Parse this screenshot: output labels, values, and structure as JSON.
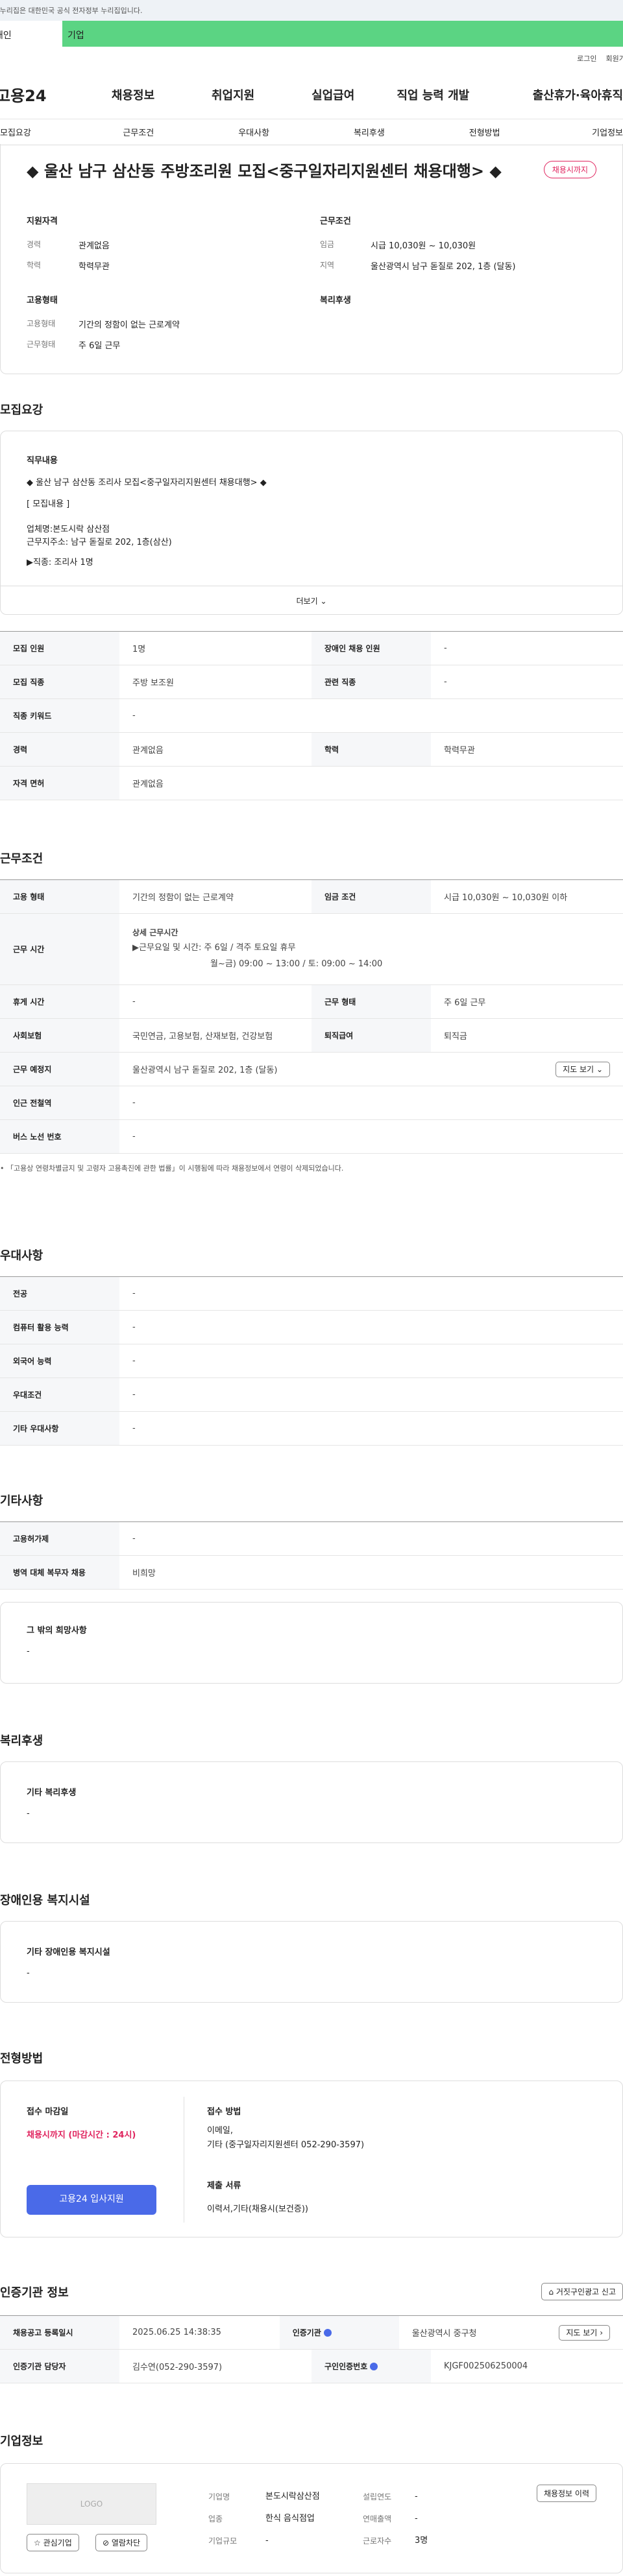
{
  "top_notice": "이 누리집은 대한민국 공식 전자정부 누리집입니다.",
  "tabs": [
    "개인",
    "기업"
  ],
  "util": [
    "로그인",
    "회원가입"
  ],
  "logo": "고용24",
  "gnb": [
    "채용정보",
    "취업지원",
    "실업급여",
    "직업 능력 개발",
    "출산휴가·육아휴직"
  ],
  "subnav": [
    "모집요강",
    "근무조건",
    "우대사항",
    "복리후생",
    "전형방법",
    "기업정보"
  ],
  "title": "◆ 울산 남구 삼산동 주방조리원 모집<중구일자리지원센터 채용대행> ◆",
  "badge": "채용시까지",
  "summary": {
    "support_h": "지원자격",
    "work_h": "근무조건",
    "emp_h": "고용형태",
    "welfare_h": "복리후생",
    "career_k": "경력",
    "career_v": "관계없음",
    "edu_k": "학력",
    "edu_v": "학력무관",
    "wage_k": "임금",
    "wage_v": "시급 10,030원 ~ 10,030원",
    "area_k": "지역",
    "area_v": "울산광역시 남구 돋질로 202, 1층 (달동)",
    "type_k": "고용형태",
    "type_v": "기간의 정함이 없는 근로계약",
    "wtype_k": "근무형태",
    "wtype_v": "주 6일 근무"
  },
  "recruit": {
    "heading": "모집요강",
    "duty_h": "직무내용",
    "lines": [
      "◆ 울산 남구 삼산동 조리사 모집<중구일자리지원센터 채용대행> ◆",
      "[ 모집내용 ]",
      "업체명:본도시락 삼산점",
      "근무지주소: 남구 돋질로 202, 1층(삼산)",
      "▶직종:  조리사 1명"
    ],
    "more": "더보기",
    "rows": [
      [
        "모집 인원",
        "1명",
        "장애인 채용 인원",
        "-"
      ],
      [
        "모집 직종",
        "주방 보조원",
        "관련 직종",
        "-"
      ],
      [
        "직종 키워드",
        "-"
      ],
      [
        "경력",
        "관계없음",
        "학력",
        "학력무관"
      ],
      [
        "자격 면허",
        "관계없음"
      ]
    ]
  },
  "work": {
    "heading": "근무조건",
    "emp_k": "고용 형태",
    "emp_v": "기간의 정함이 없는 근로계약",
    "wage_k": "임금 조건",
    "wage_v": "시급 10,030원 ~ 10,030원 이하",
    "time_k": "근무 시간",
    "time_h": "상세 근무시간",
    "time_l1": "▶근무요일 및 시간: 주 6일 / 격주 토요일 휴무",
    "time_l2": "월~금) 09:00 ~ 13:00 / 토: 09:00 ~ 14:00",
    "rest_k": "휴게 시간",
    "rest_v": "-",
    "wtype_k": "근무 형태",
    "wtype_v": "주 6일 근무",
    "ins_k": "사회보험",
    "ins_v": "국민연금, 고용보험, 산재보험, 건강보험",
    "ret_k": "퇴직급여",
    "ret_v": "퇴직금",
    "place_k": "근무 예정지",
    "place_v": "울산광역시 남구 돋질로 202, 1층 (달동)",
    "map_btn": "지도 보기",
    "station_k": "인근 전철역",
    "station_v": "-",
    "bus_k": "버스 노선 번호",
    "bus_v": "-",
    "note": "「고용상 연령차별금지 및 고령자 고용촉진에 관한 법률」이 시행됨에 따라 채용정보에서 연령이 삭제되었습니다."
  },
  "pref": {
    "heading": "우대사항",
    "rows": [
      [
        "전공",
        "-"
      ],
      [
        "컴퓨터 활용 능력",
        "-"
      ],
      [
        "외국어 능력",
        "-"
      ],
      [
        "우대조건",
        "-"
      ],
      [
        "기타 우대사항",
        "-"
      ]
    ]
  },
  "etc": {
    "heading": "기타사항",
    "rows": [
      [
        "고용허가제",
        "-"
      ],
      [
        "병역 대체 복무자 채용",
        "비희망"
      ]
    ],
    "box_h": "그 밖의 희망사항",
    "box_v": "-"
  },
  "welfare": {
    "heading": "복리후생",
    "box_h": "기타 복리후생",
    "box_v": "-"
  },
  "disabled": {
    "heading": "장애인용 복지시설",
    "box_h": "기타 장애인용 복지시설",
    "box_v": "-"
  },
  "selection": {
    "heading": "전형방법",
    "deadline_h": "접수 마감일",
    "deadline_v": "채용시까지 (마감시간 : 24시)",
    "apply_btn": "고용24 입사지원",
    "method_h": "접수 방법",
    "method_l1": "이메일,",
    "method_l2": "기타 (중구일자리지원센터 052-290-3597)",
    "docs_h": "제출 서류",
    "docs_v": "이력서,기타(채용시(보건증))"
  },
  "cert": {
    "heading": "인증기관 정보",
    "report_btn": "거짓구인광고 신고",
    "reg_k": "채용공고 등록일시",
    "reg_v": "2025.06.25 14:38:35",
    "org_k": "인증기관",
    "org_v": "울산광역시 중구청",
    "map_btn": "지도 보기",
    "mgr_k": "인증기관 담당자",
    "mgr_v": "김수연(052-290-3597)",
    "no_k": "구인인증번호",
    "no_v": "KJGF002506250004"
  },
  "company": {
    "heading": "기업정보",
    "logo": "LOGO",
    "fav_btn": "관심기업",
    "block_btn": "열람차단",
    "name_k": "기업명",
    "name_v": "본도시락삼산점",
    "year_k": "설립연도",
    "year_v": "-",
    "ind_k": "업종",
    "ind_v": "한식 음식점업",
    "sales_k": "연매출액",
    "sales_v": "-",
    "size_k": "기업규모",
    "size_v": "-",
    "emp_k": "근로자수",
    "emp_v": "3명",
    "history_btn": "채용정보 이력"
  }
}
